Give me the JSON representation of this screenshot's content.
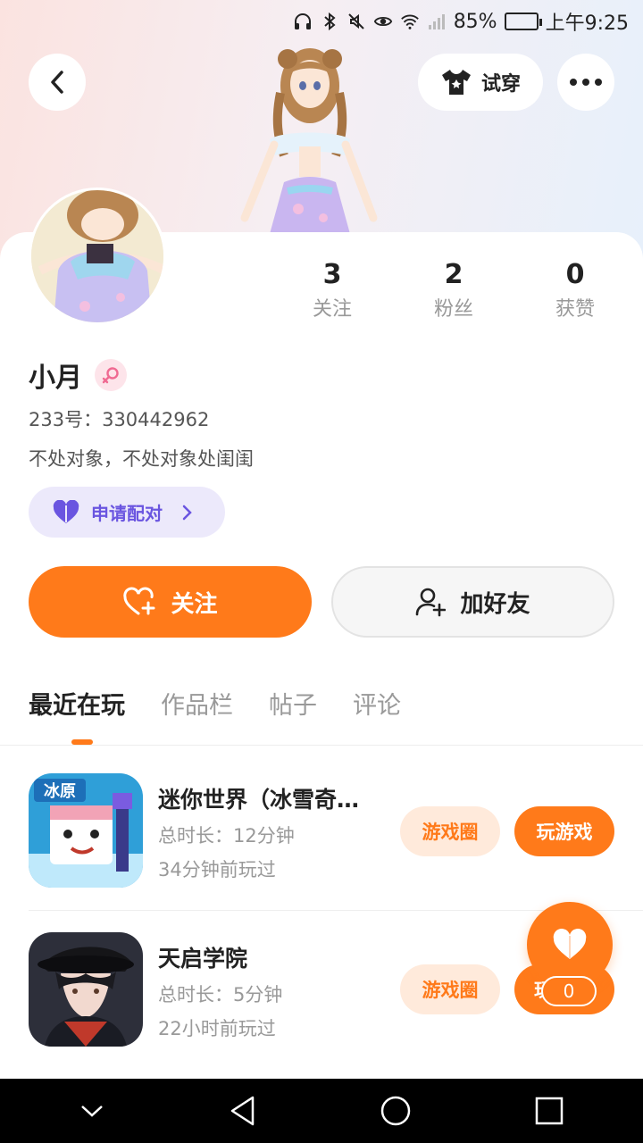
{
  "status_bar": {
    "battery": "85%",
    "battery_level": 0.85,
    "time": "上午9:25"
  },
  "header": {
    "try_on_label": "试穿"
  },
  "profile": {
    "stats": [
      {
        "value": "3",
        "label": "关注"
      },
      {
        "value": "2",
        "label": "粉丝"
      },
      {
        "value": "0",
        "label": "获赞"
      }
    ],
    "name": "小月",
    "uid": "233号：330442962",
    "bio": "不处对象，不处对象处闺闺",
    "pair_label": "申请配对"
  },
  "actions": {
    "follow_label": "关注",
    "add_friend_label": "加好友"
  },
  "tabs": [
    "最近在玩",
    "作品栏",
    "帖子",
    "评论"
  ],
  "games": [
    {
      "title": "迷你世界（冰雪奇…",
      "duration": "总时长：12分钟",
      "last_played": "34分钟前玩过",
      "circle_label": "游戏圈",
      "play_label": "玩游戏",
      "icon_text": "冰原"
    },
    {
      "title": "天启学院",
      "duration": "总时长：5分钟",
      "last_played": "22小时前玩过",
      "circle_label": "游戏圈",
      "play_label": "玩"
    }
  ],
  "like": {
    "count": "0"
  },
  "colors": {
    "accent": "#ff7a1a",
    "pair": "#6a55e0"
  }
}
